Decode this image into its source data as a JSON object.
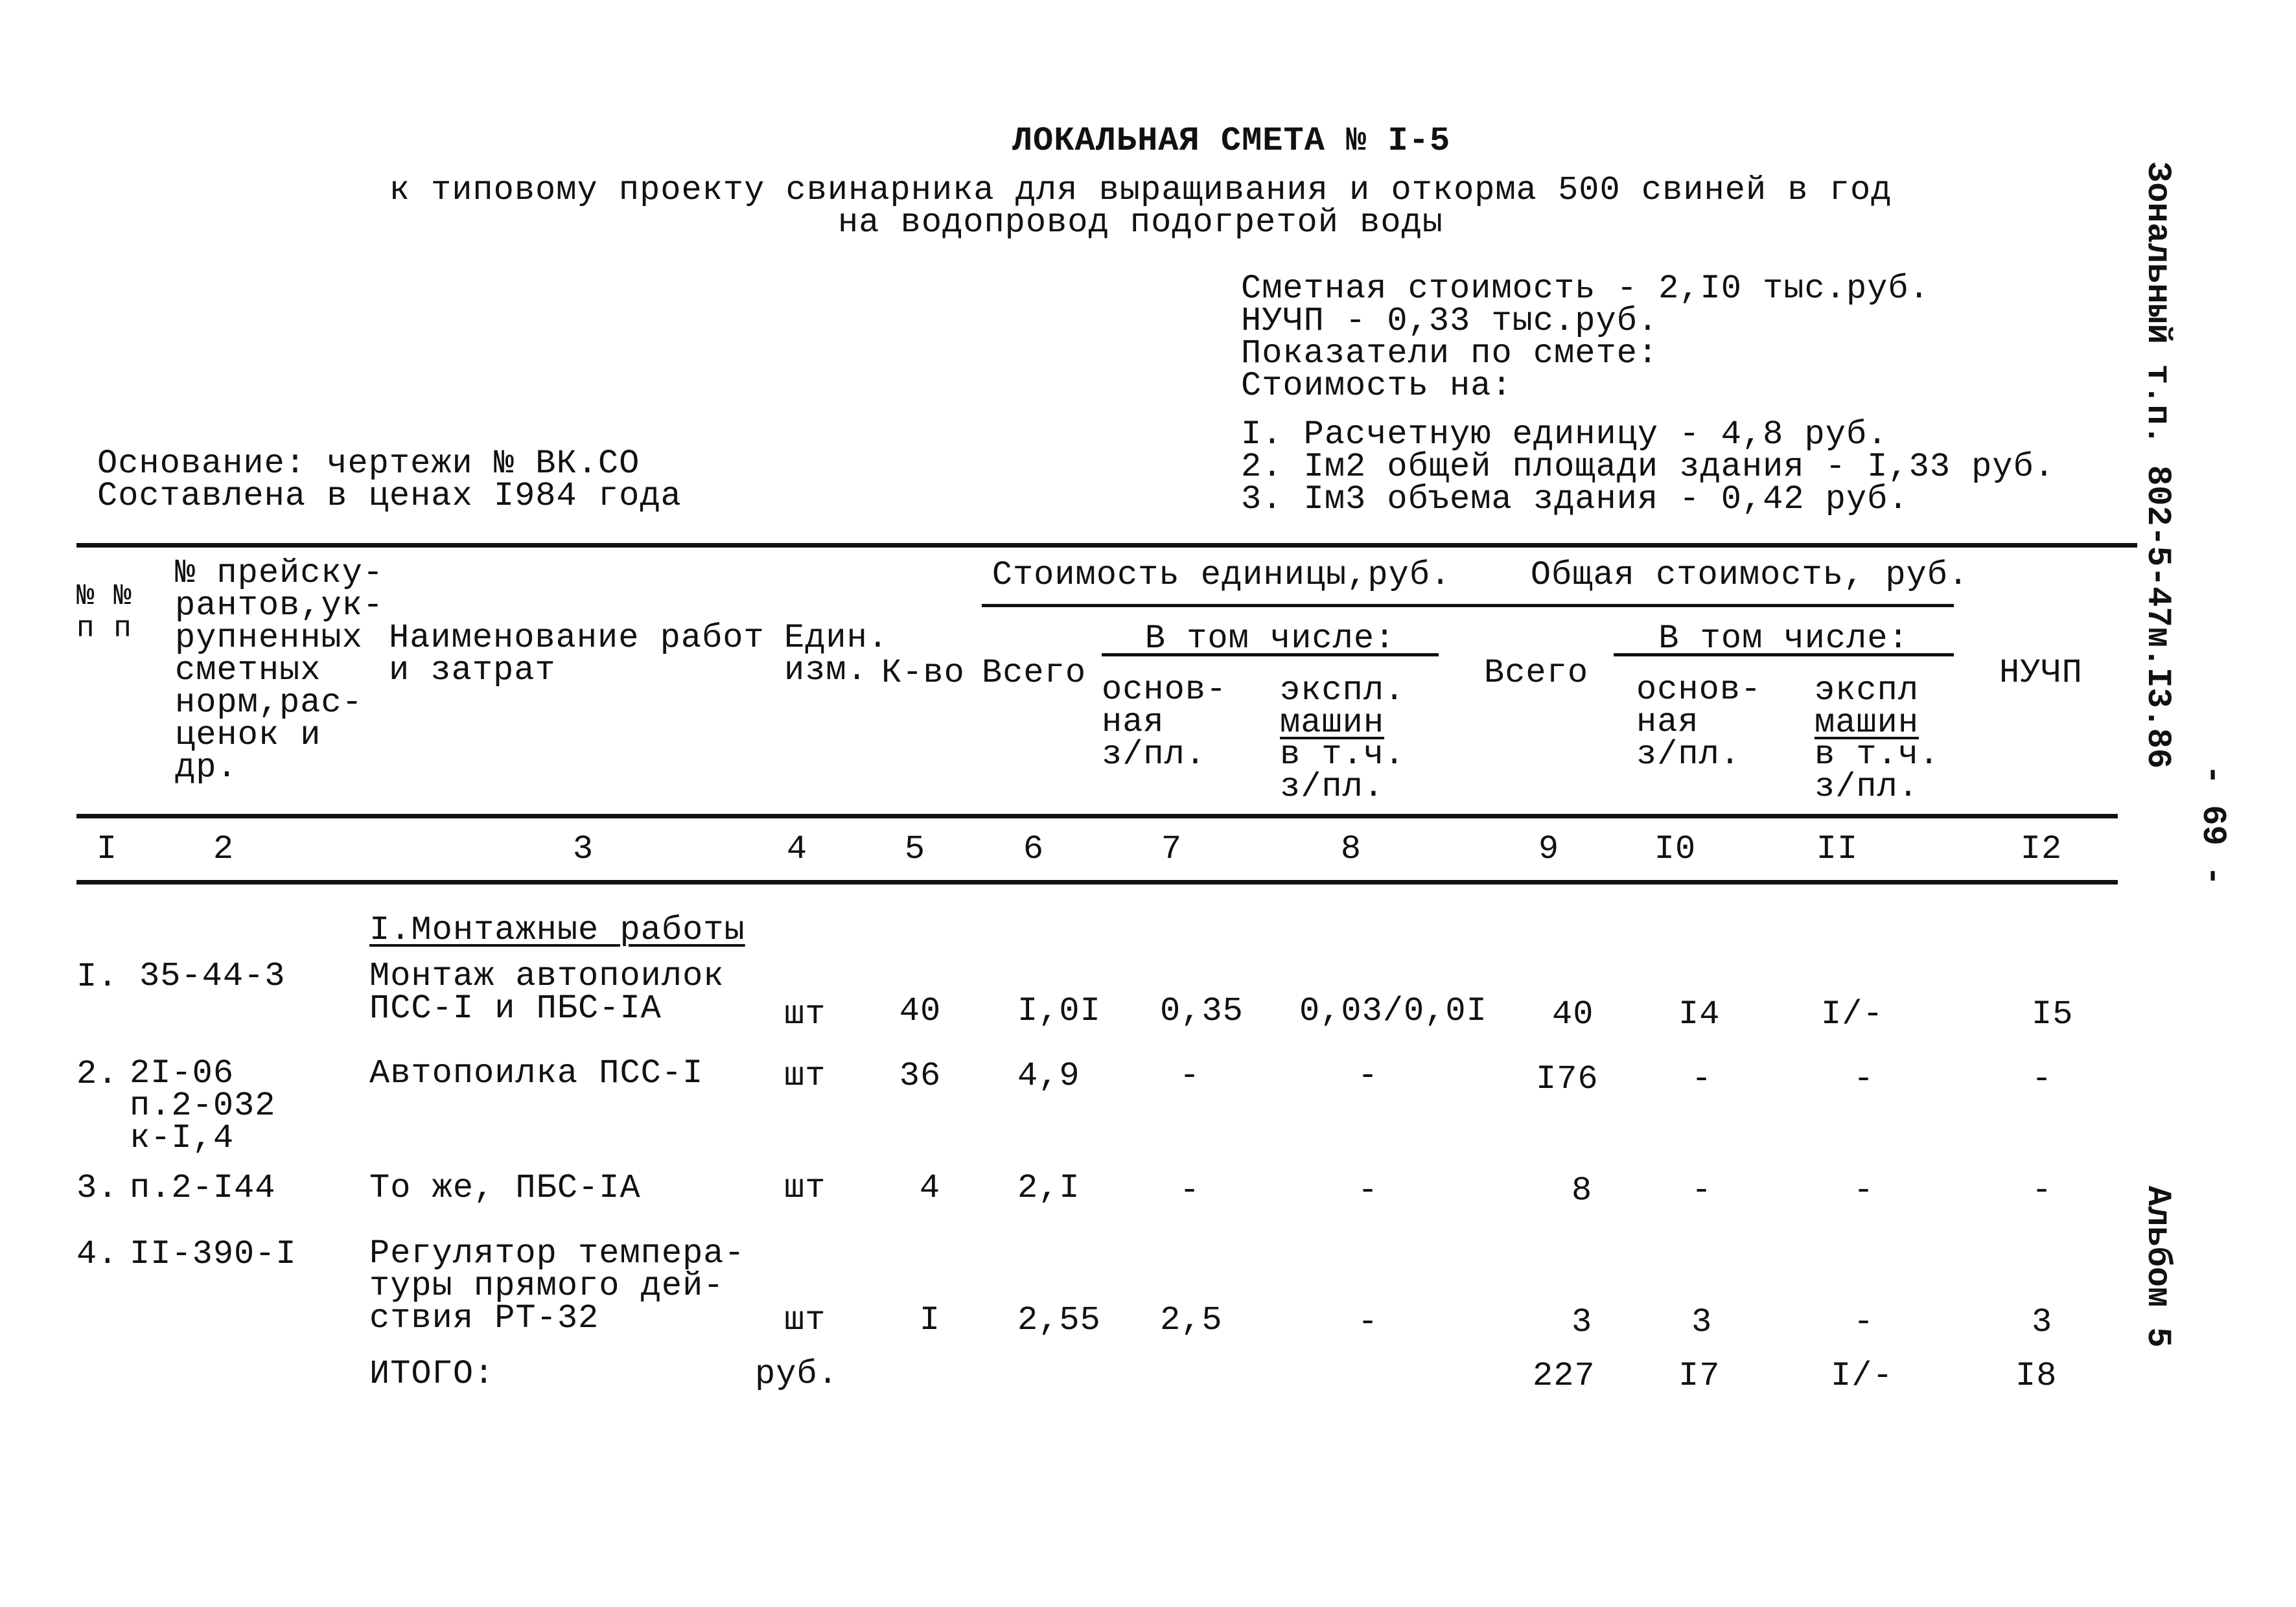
{
  "header": {
    "title": "ЛОКАЛЬНАЯ СМЕТА № I-5",
    "subtitle_line1": "к типовому проекту свинарника для выращивания и откорма 500 свиней в год",
    "subtitle_line2": "на водопровод подогретой воды"
  },
  "summary": {
    "estimated_cost": "Сметная стоимость - 2,I0 тыс.руб.",
    "nuchp": "НУЧП - 0,33 тыс.руб.",
    "indicators_label": "Показатели по смете:",
    "cost_on_label": "Стоимость на:",
    "indicators": [
      "I. Расчетную единицу - 4,8 руб.",
      "2. Iм2 общей площади здания - I,33 руб.",
      "3. Iм3 объема здания - 0,42 руб."
    ]
  },
  "basis": {
    "line1": "Основание: чертежи № ВК.СО",
    "line2": "Составлена в ценах I984 года"
  },
  "table": {
    "headers": {
      "col1": "№ №\nп п",
      "col2": "№ прейску-\nрантов,ук-\nрупненных\nсметных\nнорм,рас-\nценок и\n   др.",
      "col3": "Наименование работ\n    и затрат",
      "col4": "Един.\nизм.",
      "col5": "К-во",
      "unit_cost_group": "Стоимость единицы,руб.",
      "total_cost_group": "Общая стоимость, руб.",
      "including": "В том числе:",
      "col6": "Всего",
      "col7": "основ-\nная\nз/пл.",
      "col8_top": "экспл.",
      "col8_u": "машин",
      "col8_bottom": "в т.ч.\nз/пл.",
      "col9": "Всего",
      "col10": "основ-\nная\nз/пл.",
      "col11_top": "экспл",
      "col11_u": "машин",
      "col11_bottom": "в т.ч.\nз/пл.",
      "col12": "НУЧП"
    },
    "column_numbers": [
      "I",
      "2",
      "3",
      "4",
      "5",
      "6",
      "7",
      "8",
      "9",
      "I0",
      "II",
      "I2"
    ],
    "section_title": "I.Монтажные работы",
    "rows": [
      {
        "num": "I.",
        "code": "35-44-3",
        "name": "Монтаж автопоилок\nПСС-I и ПБС-IA",
        "unit": "шт",
        "qty": "40",
        "unit_total": "I,0I",
        "unit_wage": "0,35",
        "unit_machine": "0,03/0,0I",
        "total": "40",
        "total_wage": "I4",
        "total_machine": "I/-",
        "nuchp": "I5"
      },
      {
        "num": "2.",
        "code": "2I-06\nп.2-032\nк-I,4",
        "name": "Автопоилка ПСС-I",
        "unit": "шт",
        "qty": "36",
        "unit_total": "4,9",
        "unit_wage": "-",
        "unit_machine": "-",
        "total": "I76",
        "total_wage": "-",
        "total_machine": "-",
        "nuchp": "-"
      },
      {
        "num": "3.",
        "code": "п.2-I44",
        "name": "То же, ПБС-IA",
        "unit": "шт",
        "qty": "4",
        "unit_total": "2,I",
        "unit_wage": "-",
        "unit_machine": "-",
        "total": "8",
        "total_wage": "-",
        "total_machine": "-",
        "nuchp": "-"
      },
      {
        "num": "4.",
        "code": "II-390-I",
        "name": "Регулятор темпера-\nтуры прямого дей-\nствия РТ-32",
        "unit": "шт",
        "qty": "I",
        "unit_total": "2,55",
        "unit_wage": "2,5",
        "unit_machine": "-",
        "total": "3",
        "total_wage": "3",
        "total_machine": "-",
        "nuchp": "3"
      }
    ],
    "total_row": {
      "label": "ИТОГО:",
      "unit": "руб.",
      "total": "227",
      "total_wage": "I7",
      "total_machine": "I/-",
      "nuchp": "I8"
    }
  },
  "margin": {
    "project_code": "Зональный т.п. 802-5-47м.I3.86",
    "page_number": "- 69 -",
    "album": "Альбом 5"
  }
}
